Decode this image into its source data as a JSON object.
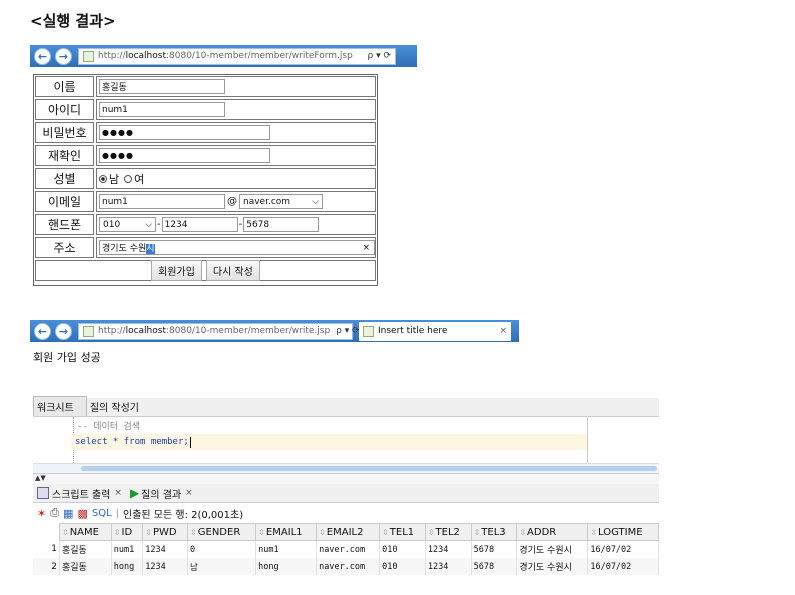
{
  "heading": "<실행 결과>",
  "browser1": {
    "url_prefix": "http://",
    "url_host": "localhost",
    "url_rest": ":8080/10-member/member/writeForm.jsp",
    "tools": "ρ ▾ ⟳",
    "back_icon": "back-arrow-icon",
    "forward_icon": "forward-arrow-icon"
  },
  "form": {
    "rows": [
      {
        "label": "이름",
        "value": "홍길동"
      },
      {
        "label": "아이디",
        "value": "num1"
      },
      {
        "label": "비밀번호",
        "value": "●●●●"
      },
      {
        "label": "재확인",
        "value": "●●●●"
      },
      {
        "label": "성별",
        "male": "남",
        "female": "여"
      },
      {
        "label": "이메일",
        "value": "num1",
        "at": "@",
        "domain": "naver.com"
      },
      {
        "label": "핸드폰",
        "p1": "010",
        "p2": "1234",
        "p3": "5678",
        "dash": "-"
      },
      {
        "label": "주소",
        "value": "경기도 수원",
        "selected": "시",
        "clear": "×"
      }
    ],
    "submit": "회원가입",
    "reset": "다시 작성"
  },
  "browser2": {
    "url_prefix": "http://",
    "url_host": "localhost",
    "url_rest": ":8080/10-member/member/write.jsp",
    "tools": "ρ ▾ ⟳",
    "tab_title": "Insert title here",
    "tab_close": "×"
  },
  "success_msg": "회원 가입 성공",
  "worksheet": {
    "tabs": [
      "워크시트",
      "질의 작성기"
    ],
    "comment": "-- 데이터 검색",
    "sql": "select * from member;",
    "split_arrows": "▲▼",
    "result_tabs": [
      {
        "label": "스크립트 출력",
        "close": "×"
      },
      {
        "label": "질의 결과",
        "close": "×"
      }
    ],
    "toolbar_sql": "SQL",
    "toolbar_sep": "|",
    "toolbar_status": "인출된 모든 행: 2(0,001초)",
    "columns": [
      "NAME",
      "ID",
      "PWD",
      "GENDER",
      "EMAIL1",
      "EMAIL2",
      "TEL1",
      "TEL2",
      "TEL3",
      "ADDR",
      "LOGTIME"
    ],
    "rows": [
      {
        "num": "1",
        "cells": [
          "홍길동",
          "num1",
          "1234",
          "0",
          "num1",
          "naver.com",
          "010",
          "1234",
          "5678",
          "경기도 수원시",
          "16/07/02"
        ]
      },
      {
        "num": "2",
        "cells": [
          "홍길동",
          "hong",
          "1234",
          "남",
          "hong",
          "naver.com",
          "010",
          "1234",
          "5678",
          "경기도 수원시",
          "16/07/02"
        ]
      }
    ]
  }
}
